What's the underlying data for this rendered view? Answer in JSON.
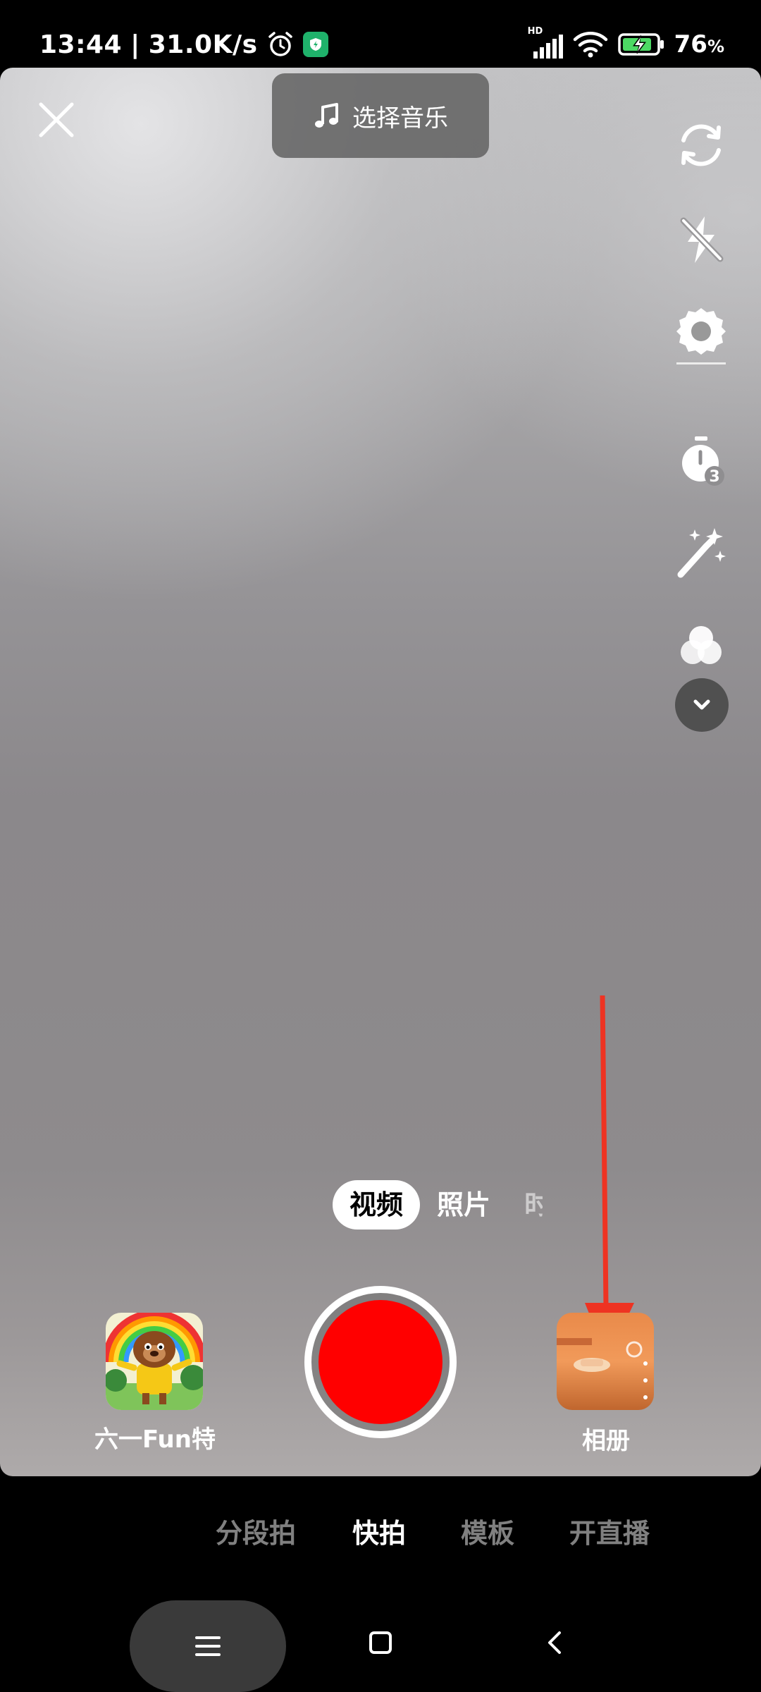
{
  "status_bar": {
    "time": "13:44",
    "network_speed": "31.0K/s",
    "signal_label": "HD",
    "battery": "76",
    "battery_unit": "%",
    "icons": [
      "alarm-icon",
      "shield-app-icon",
      "signal-icon",
      "wifi-icon",
      "battery-charging-icon"
    ]
  },
  "camera": {
    "music_button": "选择音乐",
    "right_tools": [
      "flip-camera-icon",
      "flash-off-icon",
      "settings-icon",
      "timer-3s-icon",
      "beauty-wand-icon",
      "filter-icon",
      "more-chevron-icon"
    ],
    "timer_value": "3"
  },
  "modes": {
    "video": "视频",
    "photo": "照片",
    "partial": "时"
  },
  "bottom": {
    "prop_label": "六一Fun特",
    "album_label": "相册"
  },
  "tabs": {
    "segment": "分段拍",
    "quick": "快拍",
    "template": "模板",
    "live": "开直播"
  },
  "colors": {
    "record": "#ff0000",
    "annotation_arrow": "#ee3322"
  }
}
